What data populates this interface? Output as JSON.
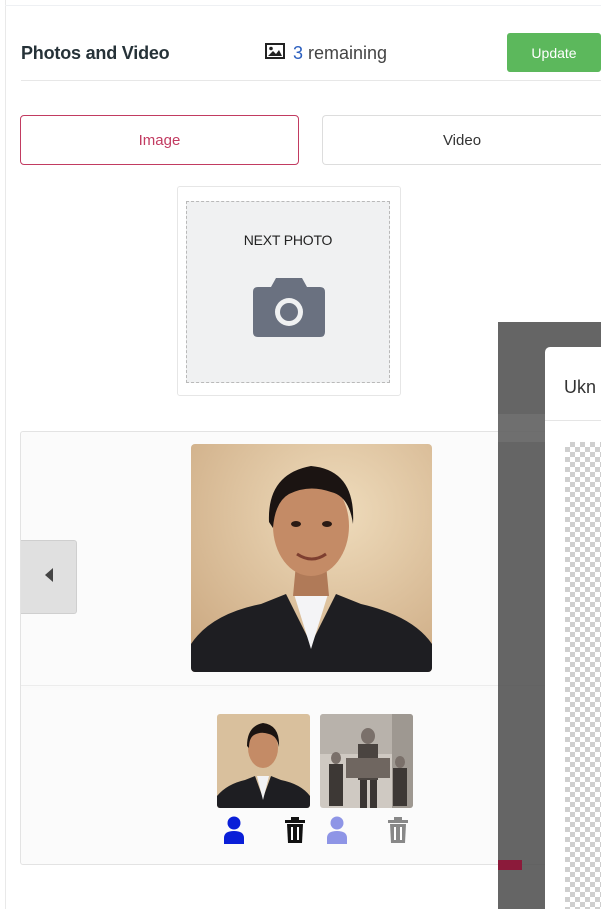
{
  "header": {
    "title": "Photos and Video",
    "remaining_count": "3",
    "remaining_label": "remaining",
    "update_label": "Update"
  },
  "tabs": [
    {
      "label": "Image",
      "active": true
    },
    {
      "label": "Video",
      "active": false
    }
  ],
  "next_photo": {
    "label": "NEXT PHOTO",
    "icon": "camera-icon"
  },
  "gallery": {
    "prev_icon": "caret-left-icon",
    "thumbnails": [
      {
        "name": "portrait-thumbnail",
        "icons": [
          "user-icon",
          "trash-icon"
        ]
      },
      {
        "name": "family-photo-thumbnail",
        "icons": [
          "user-icon",
          "trash-icon"
        ]
      }
    ]
  },
  "modal": {
    "title": "Ukn"
  },
  "colors": {
    "accent": "#c23b61",
    "update_button": "#5cb85c",
    "count_blue": "#2b5fbf",
    "user_icon_active": "#0a1fd8",
    "user_icon_inactive": "#8e95e6"
  }
}
